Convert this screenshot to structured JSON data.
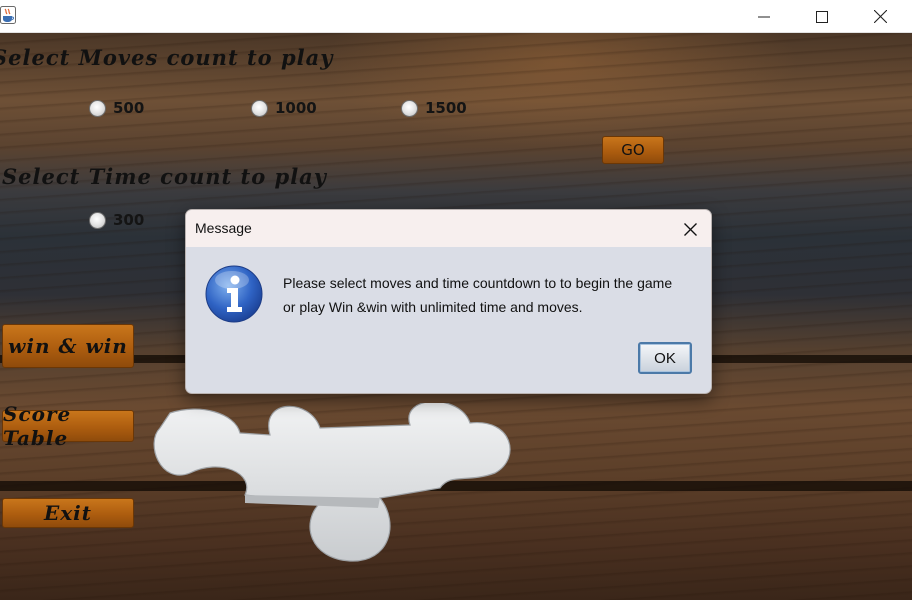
{
  "window": {
    "icon": "java-coffee-cup-icon",
    "controls": [
      "minimize-icon",
      "maximize-icon",
      "close-icon"
    ]
  },
  "moves": {
    "heading": "Select Moves count to play",
    "options": [
      "500",
      "1000",
      "1500"
    ],
    "go_label": "GO"
  },
  "time": {
    "heading": "Select Time count to play",
    "options": [
      "300"
    ]
  },
  "menu": {
    "win_label": "win & win",
    "score_label": "Score Table",
    "exit_label": "Exit"
  },
  "dialog": {
    "title": "Message",
    "line1": "Please select moves and time countdown to to begin the game",
    "line2": "or play Win &win with unlimited time and moves.",
    "ok_label": "OK",
    "icon": "info-icon"
  },
  "colors": {
    "accent_button": "#b0600f",
    "dialog_bg": "#dadde6",
    "dialog_titlebar": "#f7efee",
    "ok_border": "#4b79a8"
  }
}
